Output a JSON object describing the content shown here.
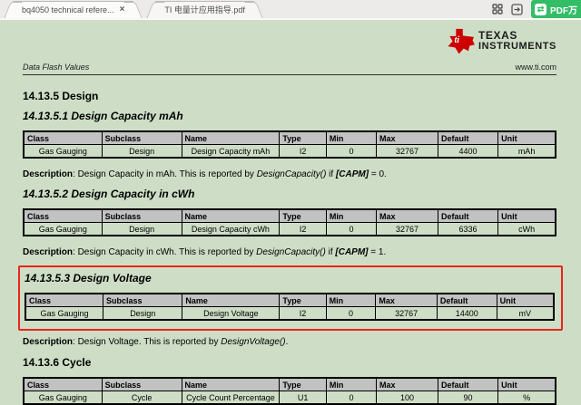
{
  "browser": {
    "tab1": {
      "title": "bq4050 technical refere...",
      "close": "×"
    },
    "tab2": {
      "title": "TI 电量计应用指导.pdf"
    },
    "extension": {
      "label": "PDF万",
      "icon": "convert-arrows",
      "swap_glyph": "⇄"
    }
  },
  "doc": {
    "logo_line1": "TEXAS",
    "logo_line2": "INSTRUMENTS",
    "running_header": "Data Flash Values",
    "website": "www.ti.com",
    "sections": {
      "s5": "14.13.5 Design",
      "s51": "14.13.5.1 Design Capacity mAh",
      "s52": "14.13.5.2 Design Capacity in cWh",
      "s53": "14.13.5.3 Design Voltage",
      "s6": "14.13.6 Cycle"
    },
    "table_headers": [
      "Class",
      "Subclass",
      "Name",
      "Type",
      "Min",
      "Max",
      "Default",
      "Unit"
    ],
    "tables": {
      "t1": {
        "cells": [
          "Gas Gauging",
          "Design",
          "Design Capacity mAh",
          "I2",
          "0",
          "32767",
          "4400",
          "mAh"
        ]
      },
      "t2": {
        "cells": [
          "Gas Gauging",
          "Design",
          "Design Capacity cWh",
          "I2",
          "0",
          "32767",
          "6336",
          "cWh"
        ]
      },
      "t3": {
        "cells": [
          "Gas Gauging",
          "Design",
          "Design Voltage",
          "I2",
          "0",
          "32767",
          "14400",
          "mV"
        ]
      },
      "t4": {
        "cells": [
          "Gas Gauging",
          "Cycle",
          "Cycle Count Percentage",
          "U1",
          "0",
          "100",
          "90",
          "%"
        ]
      }
    },
    "descriptions": {
      "d1": {
        "label": "Description",
        "pre": ": Design Capacity in mAh. This is reported by ",
        "func": "DesignCapacity()",
        "mid": " if ",
        "flag": "[CAPM]",
        "post": " = 0."
      },
      "d2": {
        "label": "Description",
        "pre": ": Design Capacity in cWh. This is reported by ",
        "func": "DesignCapacity()",
        "mid": " if ",
        "flag": "[CAPM]",
        "post": " = 1."
      },
      "d3": {
        "label": "Description",
        "pre": ": Design Voltage. This is reported by ",
        "func": "DesignVoltage()",
        "post": "."
      }
    }
  },
  "colors": {
    "page_bg": "#cedec6",
    "table_header_bg": "#c2c2c2",
    "annotation_red": "#e8261d",
    "ti_logo_red": "#cc0000",
    "extension_green": "#33bd66"
  }
}
